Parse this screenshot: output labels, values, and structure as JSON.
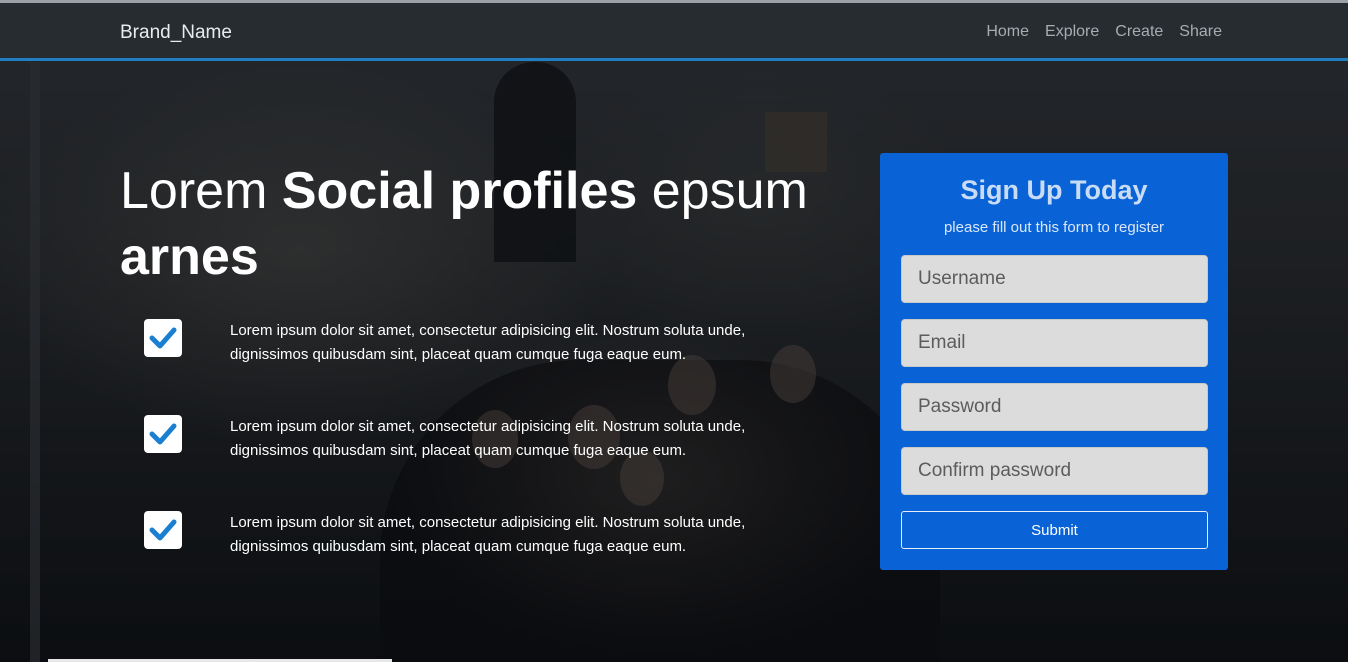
{
  "navbar": {
    "brand": "Brand_Name",
    "links": [
      "Home",
      "Explore",
      "Create",
      "Share"
    ]
  },
  "hero": {
    "headline_pre": "Lorem ",
    "headline_bold": "Social profiles",
    "headline_mid": " epsum ",
    "headline_bold2": "arnes",
    "features": [
      "Lorem ipsum dolor sit amet, consectetur adipisicing elit. Nostrum soluta unde, dignissimos quibusdam sint, placeat quam cumque fuga eaque eum.",
      "Lorem ipsum dolor sit amet, consectetur adipisicing elit. Nostrum soluta unde, dignissimos quibusdam sint, placeat quam cumque fuga eaque eum.",
      "Lorem ipsum dolor sit amet, consectetur adipisicing elit. Nostrum soluta unde, dignissimos quibusdam sint, placeat quam cumque fuga eaque eum."
    ]
  },
  "signup": {
    "title": "Sign Up Today",
    "subtitle": "please fill out this form to register",
    "username_placeholder": "Username",
    "email_placeholder": "Email",
    "password_placeholder": "Password",
    "confirm_placeholder": "Confirm password",
    "submit_label": "Submit"
  },
  "icons": {
    "feature_check": "check-icon"
  },
  "colors": {
    "card": "#0a63d6",
    "nav_accent": "#1f7fc0",
    "check": "#1a7fd1"
  }
}
